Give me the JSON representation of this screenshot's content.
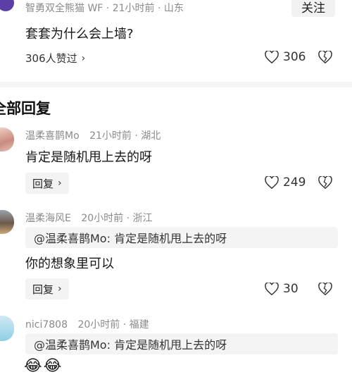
{
  "top_comment": {
    "author_meta": "智勇双全熊猫 WF · 21小时前 · 山东",
    "follow_label": "关注",
    "text": "套套为什么会上墙?",
    "likers_summary": "306人赞过",
    "like_count": "306"
  },
  "section_title": "全部回复",
  "replies": [
    {
      "author": "温柔喜鹊Mo",
      "meta": "21小时前 · 湖北",
      "text": "肯定是随机甩上去的呀",
      "reply_label": "回复",
      "like_count": "249"
    },
    {
      "author": "温柔海风E",
      "meta": "20小时前 · 浙江",
      "quote": "@温柔喜鹊Mo: 肯定是随机甩上去的呀",
      "text": "你的想象里可以",
      "reply_label": "回复",
      "like_count": "30"
    },
    {
      "author": "nici7808",
      "meta": "20小时前 · 福建",
      "quote": "@温柔喜鹊Mo: 肯定是随机甩上去的呀",
      "emoji": "😂😂"
    }
  ],
  "icons": {
    "heart": "heart-icon",
    "dislike": "broken-heart-icon",
    "chevron": "chevron-right-icon"
  }
}
